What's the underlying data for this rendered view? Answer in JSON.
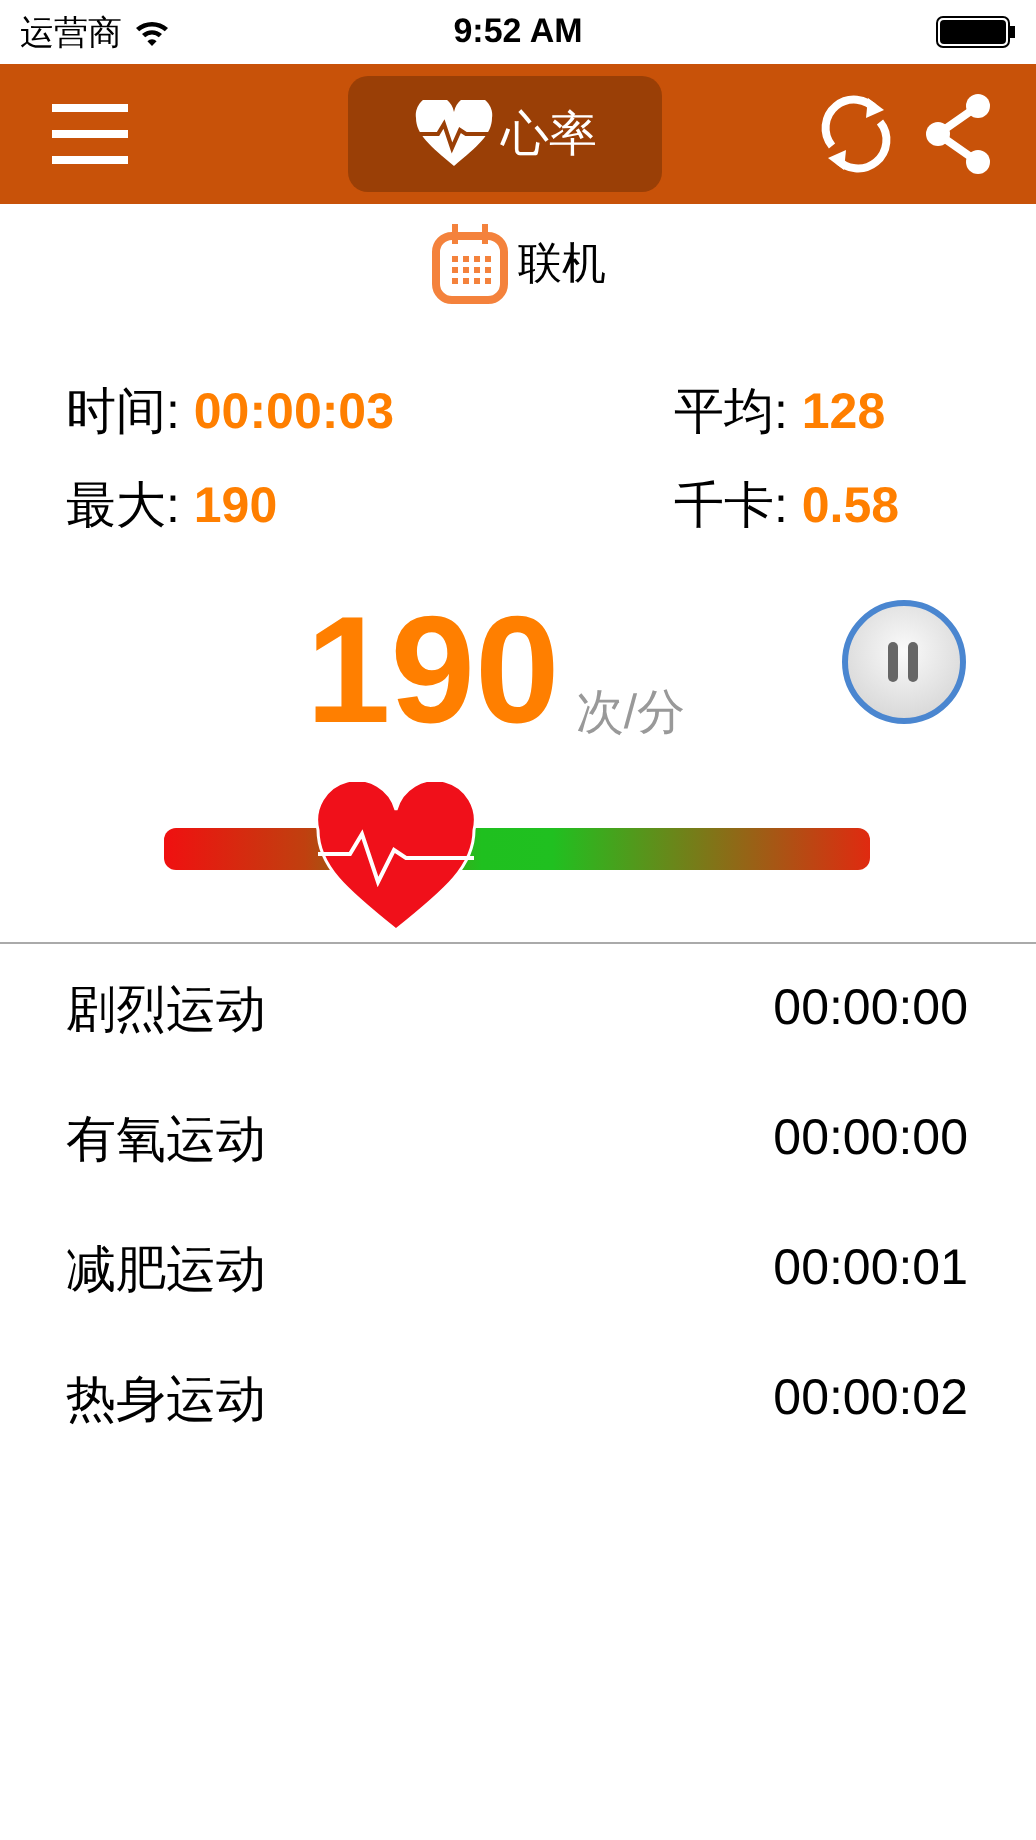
{
  "status_bar": {
    "carrier": "运营商",
    "time": "9:52 AM"
  },
  "header": {
    "title": "心率"
  },
  "connection": {
    "label": "联机"
  },
  "stats": [
    {
      "label": "时间:",
      "value": "00:00:03"
    },
    {
      "label": "平均:",
      "value": "128"
    },
    {
      "label": "最大:",
      "value": "190"
    },
    {
      "label": "千卡:",
      "value": "0.58"
    }
  ],
  "heart_rate": {
    "value": "190",
    "unit": "次/分",
    "level": 0.33
  },
  "zones": [
    {
      "name": "剧烈运动",
      "duration": "00:00:00"
    },
    {
      "name": "有氧运动",
      "duration": "00:00:00"
    },
    {
      "name": "减肥运动",
      "duration": "00:00:01"
    },
    {
      "name": "热身运动",
      "duration": "00:00:02"
    }
  ]
}
